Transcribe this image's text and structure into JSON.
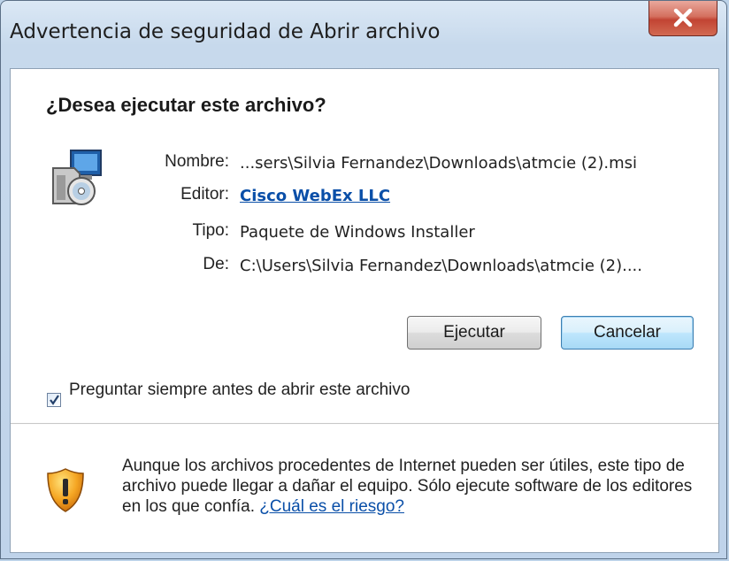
{
  "window": {
    "title": "Advertencia de seguridad de Abrir archivo"
  },
  "dialog": {
    "question": "¿Desea ejecutar este archivo?",
    "fields": [
      {
        "label": "Nombre:",
        "value": "...sers\\Silvia Fernandez\\Downloads\\atmcie (2).msi"
      },
      {
        "label": "Editor:",
        "value": "Cisco WebEx LLC"
      },
      {
        "label": "Tipo:",
        "value": "Paquete de Windows Installer"
      },
      {
        "label": "De:",
        "value": "C:\\Users\\Silvia Fernandez\\Downloads\\atmcie (2)...."
      }
    ],
    "buttons": {
      "run": "Ejecutar",
      "cancel": "Cancelar"
    },
    "checkbox": {
      "label": "Preguntar siempre antes de abrir este archivo",
      "checked": true
    },
    "warning": {
      "text": "Aunque los archivos procedentes de Internet pueden ser útiles, este tipo de archivo puede llegar a dañar el equipo. Sólo ejecute software de los editores en los que confía.",
      "link": "¿Cuál es el riesgo?"
    }
  },
  "colors": {
    "link": "#0a4fa8",
    "close_button": "#c24433",
    "default_button_border": "#3c7fb1"
  },
  "icons": [
    "close-icon",
    "installer-package-icon",
    "checkmark-icon",
    "security-shield-icon"
  ]
}
